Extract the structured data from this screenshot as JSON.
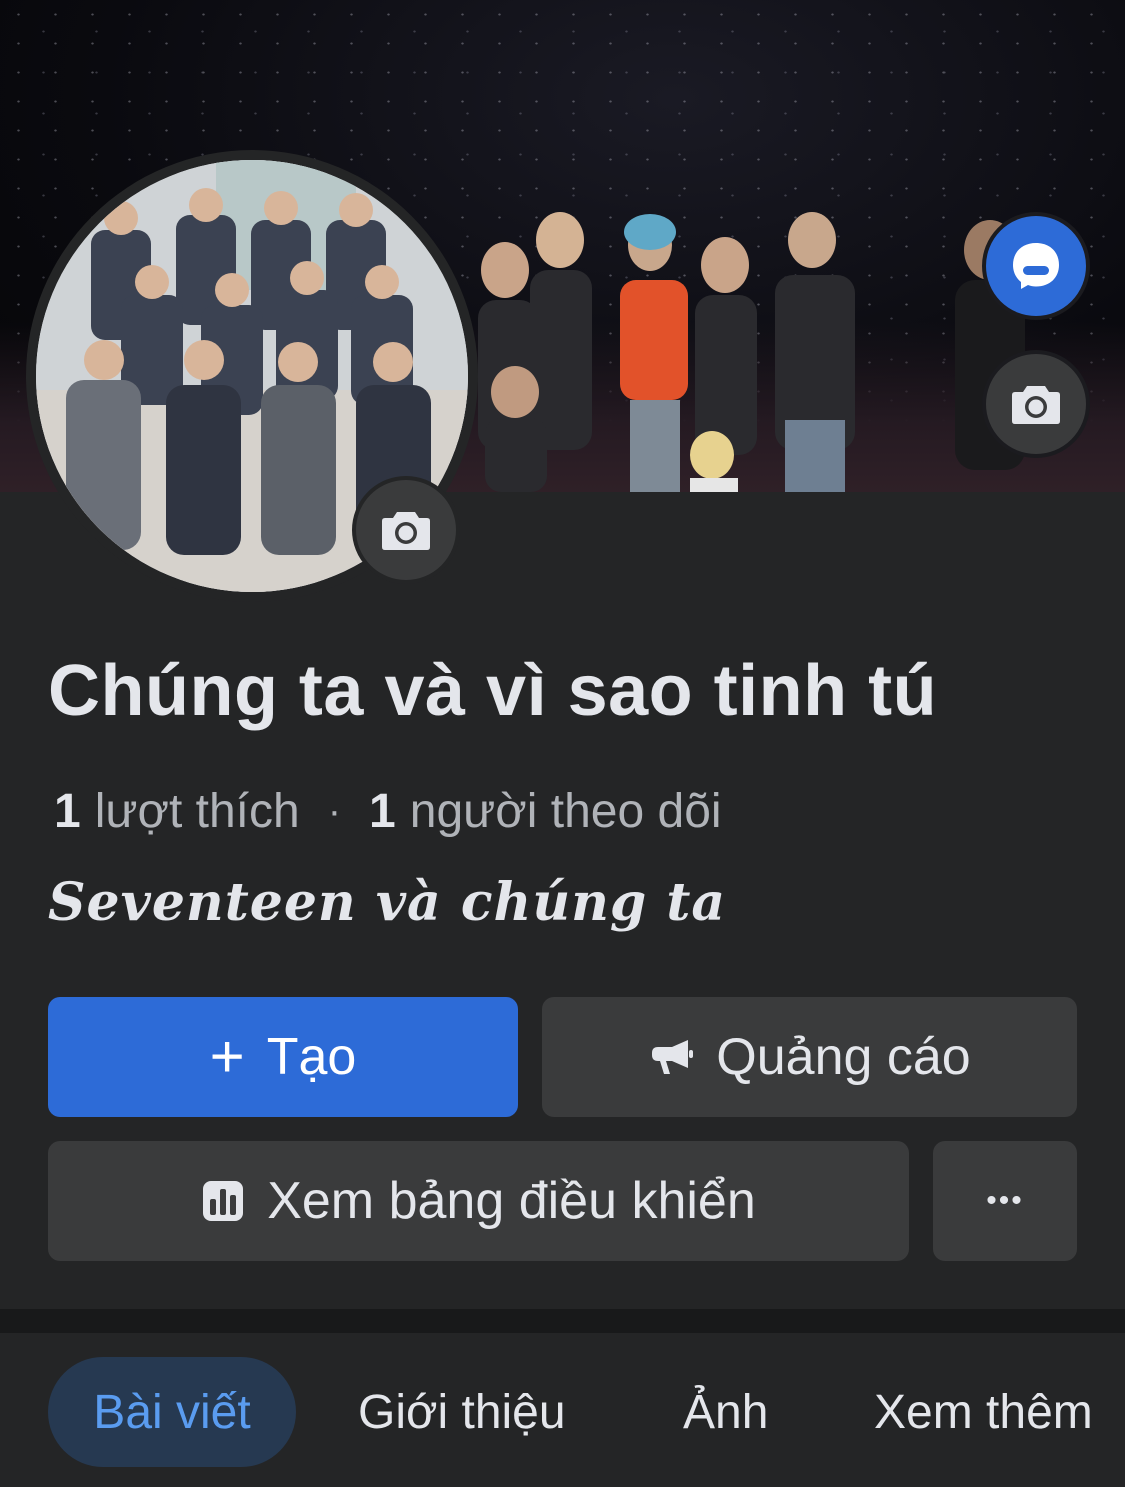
{
  "page": {
    "title": "Chúng ta và vì sao tinh tú",
    "likes_count": "1",
    "likes_label": "lượt thích",
    "separator": "·",
    "followers_count": "1",
    "followers_label": "người theo dõi",
    "tagline": "Seventeen và chúng ta"
  },
  "actions": {
    "create_icon": "+",
    "create_label": "Tạo",
    "ads_label": "Quảng cáo",
    "dashboard_label": "Xem bảng điều khiển",
    "more_label": "•••"
  },
  "tabs": [
    {
      "label": "Bài viết",
      "active": true
    },
    {
      "label": "Giới thiệu",
      "active": false
    },
    {
      "label": "Ảnh",
      "active": false
    },
    {
      "label": "Xem thêm",
      "active": false
    }
  ],
  "colors": {
    "background": "#242526",
    "primary": "#2d6bd7",
    "secondary_button": "#3a3b3c",
    "active_tab_bg": "#263951",
    "active_tab_text": "#5a9cf0"
  },
  "icons": [
    "camera-icon",
    "messenger-icon",
    "plus-icon",
    "megaphone-icon",
    "bar-chart-icon",
    "more-icon"
  ]
}
